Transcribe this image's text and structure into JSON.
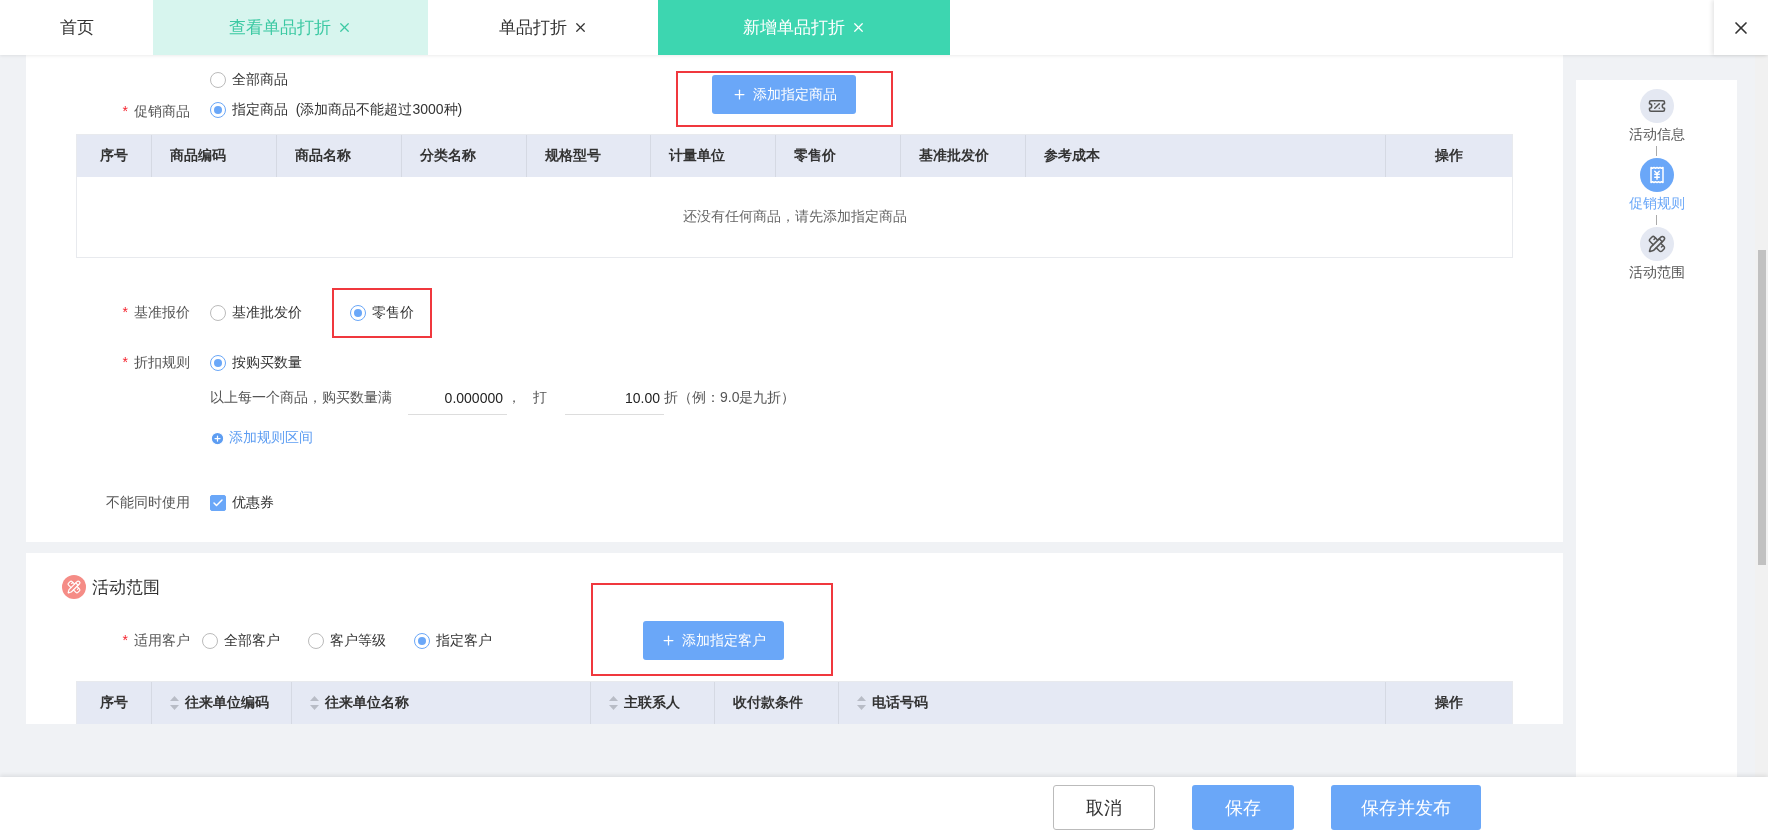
{
  "tabs": [
    {
      "label": "首页",
      "selected": false,
      "visited": false,
      "closable": false
    },
    {
      "label": "查看单品打折",
      "selected": false,
      "visited": true,
      "closable": true
    },
    {
      "label": "单品打折",
      "selected": false,
      "visited": false,
      "closable": true
    },
    {
      "label": "新增单品打折",
      "selected": true,
      "closable": true
    }
  ],
  "rules": {
    "products": {
      "label": "促销商品",
      "required_mark": "*",
      "options": [
        {
          "label": "全部商品",
          "selected": false
        },
        {
          "label": "指定商品",
          "note": "(添加商品不能超过3000种)",
          "selected": true
        }
      ],
      "add_button": {
        "label": "添加指定商品",
        "highlighted": true
      }
    },
    "products_table": {
      "columns": [
        {
          "label": "序号"
        },
        {
          "label": "商品编码"
        },
        {
          "label": "商品名称"
        },
        {
          "label": "分类名称"
        },
        {
          "label": "规格型号"
        },
        {
          "label": "计量单位"
        },
        {
          "label": "零售价"
        },
        {
          "label": "基准批发价"
        },
        {
          "label": "参考成本"
        },
        {
          "label": "操作"
        }
      ],
      "empty_text": "还没有任何商品，请先添加指定商品"
    },
    "base_price": {
      "label": "基准报价",
      "required_mark": "*",
      "options": [
        {
          "label": "基准批发价",
          "selected": false,
          "highlighted": false
        },
        {
          "label": "零售价",
          "selected": true,
          "highlighted": true
        }
      ]
    },
    "discount_rule": {
      "label": "折扣规则",
      "required_mark": "*",
      "options": [
        {
          "label": "按购买数量",
          "selected": true
        }
      ],
      "condition_text": "以上每一个商品，购买数量满",
      "quantity": "0.000000",
      "separator": "，",
      "discount_word": "打",
      "discount": "10.00",
      "hint": "折（例：9.0是九折）",
      "add_link": "添加规则区间"
    },
    "exclusive": {
      "label": "不能同时使用",
      "options": [
        {
          "label": "优惠券",
          "checked": true
        }
      ]
    }
  },
  "scope": {
    "title": "活动范围",
    "customers": {
      "label": "适用客户",
      "required_mark": "*",
      "options": [
        {
          "label": "全部客户",
          "selected": false
        },
        {
          "label": "客户等级",
          "selected": false
        },
        {
          "label": "指定客户",
          "selected": true
        }
      ],
      "add_button": {
        "label": "添加指定客户",
        "highlighted": true
      }
    },
    "table": {
      "columns": [
        {
          "label": "序号",
          "sortable": false
        },
        {
          "label": "往来单位编码",
          "sortable": true
        },
        {
          "label": "往来单位名称",
          "sortable": true
        },
        {
          "label": "主联系人",
          "sortable": true
        },
        {
          "label": "收付款条件",
          "sortable": false
        },
        {
          "label": "电话号码",
          "sortable": true
        },
        {
          "label": "操作",
          "sortable": false
        }
      ]
    }
  },
  "side_nav": {
    "items": [
      {
        "label": "活动信息",
        "kind": "info",
        "selected": false
      },
      {
        "label": "促销规则",
        "kind": "rules",
        "selected": true
      },
      {
        "label": "活动范围",
        "kind": "scope",
        "selected": false
      }
    ]
  },
  "footer": {
    "buttons": [
      {
        "label": "取消",
        "kind": "secondary"
      },
      {
        "label": "保存",
        "kind": "primary"
      },
      {
        "label": "保存并发布",
        "kind": "primary"
      }
    ]
  }
}
